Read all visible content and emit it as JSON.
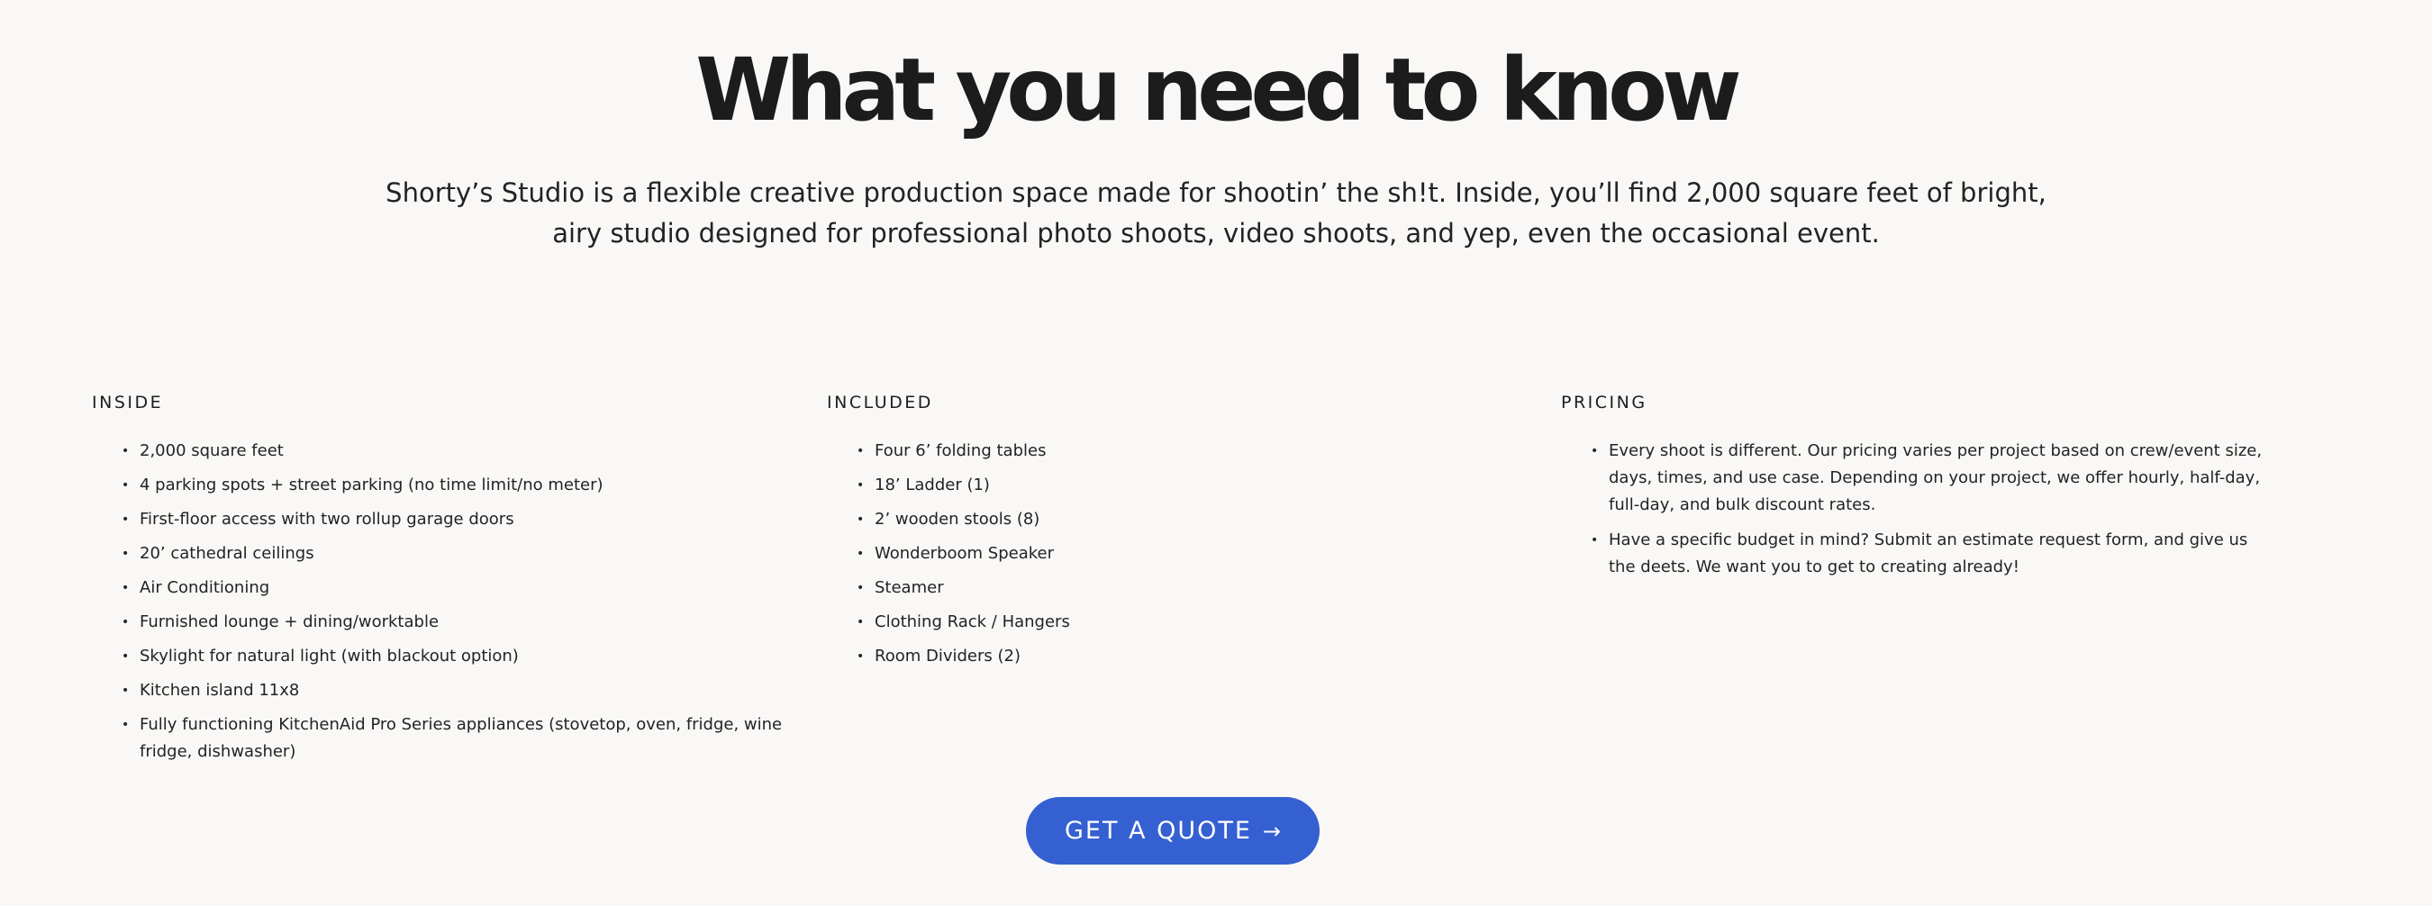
{
  "title": "What you need to know",
  "intro": "Shorty’s Studio is a flexible creative production space made for shootin’ the sh!t. Inside, you’ll find 2,000 square feet of bright, airy studio designed for professional photo shoots, video shoots, and yep, even the occasional event.",
  "inside": {
    "heading": "INSIDE",
    "items": [
      "2,000 square feet",
      "4 parking spots + street parking (no time limit/no meter)",
      "First-floor access with two rollup garage doors",
      "20’ cathedral ceilings",
      "Air Conditioning",
      "Furnished lounge + dining/worktable",
      "Skylight for natural light (with blackout option)",
      "Kitchen island 11x8",
      "Fully functioning KitchenAid Pro Series appliances (stovetop, oven, fridge, wine fridge, dishwasher)"
    ]
  },
  "included": {
    "heading": "INCLUDED",
    "items": [
      "Four 6’ folding tables",
      "18’ Ladder (1)",
      "2’ wooden stools (8)",
      "Wonderboom Speaker",
      "Steamer",
      "Clothing Rack / Hangers",
      "Room Dividers (2)"
    ]
  },
  "pricing": {
    "heading": "PRICING",
    "items": [
      "Every shoot is different. Our pricing varies per project based on crew/event size, days, times, and use case. Depending on your project, we offer hourly, half-day, full-day, and bulk discount rates.",
      "Have a specific budget in mind? Submit an estimate request form, and give us the deets. We want you to get to creating already!"
    ]
  },
  "cta": {
    "label": "GET A QUOTE",
    "icon": "→",
    "color": "#3560d2"
  }
}
